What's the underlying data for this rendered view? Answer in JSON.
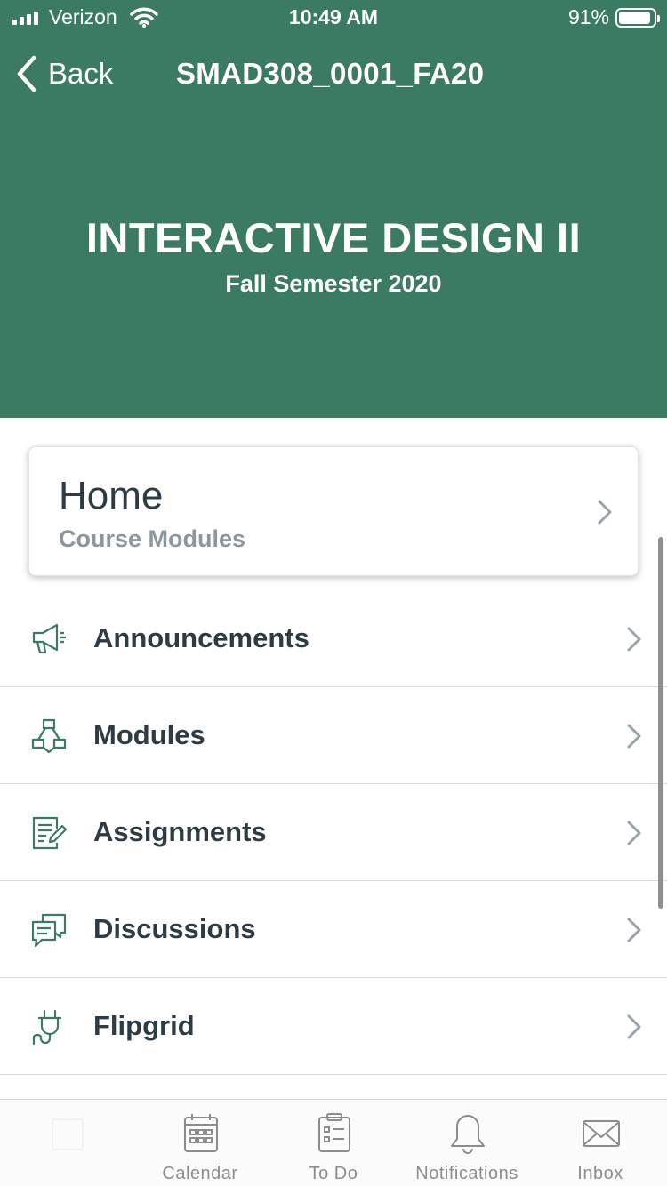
{
  "status_bar": {
    "carrier": "Verizon",
    "time": "10:49 AM",
    "battery_percent": "91%",
    "battery_level": 0.91,
    "signal_bars": 4
  },
  "nav_bar": {
    "back_label": "Back",
    "course_code": "SMAD308_0001_FA20"
  },
  "course": {
    "title": "INTERACTIVE DESIGN II",
    "term": "Fall Semester 2020"
  },
  "home_card": {
    "title": "Home",
    "subtitle": "Course Modules"
  },
  "menu": {
    "items": [
      {
        "label": "Announcements",
        "icon": "megaphone-icon"
      },
      {
        "label": "Modules",
        "icon": "modules-icon"
      },
      {
        "label": "Assignments",
        "icon": "assignment-icon"
      },
      {
        "label": "Discussions",
        "icon": "discussion-icon"
      },
      {
        "label": "Flipgrid",
        "icon": "plug-icon"
      }
    ]
  },
  "tab_bar": {
    "tabs": [
      {
        "label": "",
        "icon": "dashboard-icon"
      },
      {
        "label": "Calendar",
        "icon": "calendar-icon"
      },
      {
        "label": "To Do",
        "icon": "todo-icon"
      },
      {
        "label": "Notifications",
        "icon": "bell-icon"
      },
      {
        "label": "Inbox",
        "icon": "inbox-icon"
      }
    ]
  },
  "colors": {
    "brand": "#3b7b62",
    "text": "#2d3b45",
    "muted": "#8b969e",
    "tab_inactive": "#8c8c8c"
  }
}
